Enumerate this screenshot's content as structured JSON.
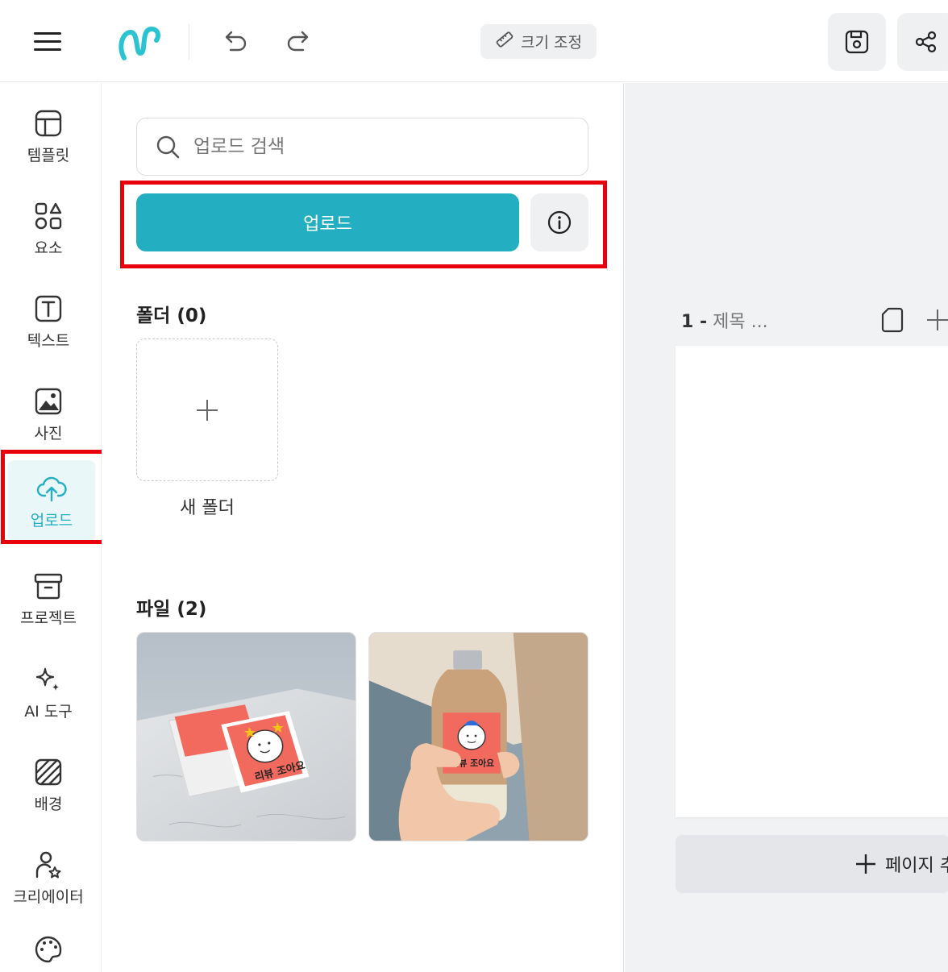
{
  "header": {
    "resize_label": "크기 조정"
  },
  "rail": {
    "items": [
      {
        "label": "템플릿",
        "icon": "template-icon"
      },
      {
        "label": "요소",
        "icon": "elements-icon"
      },
      {
        "label": "텍스트",
        "icon": "text-icon"
      },
      {
        "label": "사진",
        "icon": "photo-icon"
      },
      {
        "label": "업로드",
        "icon": "upload-cloud-icon",
        "active": true
      },
      {
        "label": "프로젝트",
        "icon": "archive-icon"
      },
      {
        "label": "AI 도구",
        "icon": "sparkle-icon"
      },
      {
        "label": "배경",
        "icon": "background-icon"
      },
      {
        "label": "크리에이터",
        "icon": "creator-icon"
      },
      {
        "label": "",
        "icon": "palette-icon"
      }
    ]
  },
  "panel": {
    "search_placeholder": "업로드 검색",
    "upload_label": "업로드",
    "folders_title": "폴더 (0)",
    "new_folder_label": "새 폴더",
    "files_title": "파일 (2)",
    "files": [
      {
        "name": "sticker-cards-photo",
        "sticker_text": "리뷰 조아요"
      },
      {
        "name": "bottle-sticker-photo",
        "sticker_text": "리뷰 조아요"
      }
    ]
  },
  "canvas": {
    "page_number": "1 -",
    "page_title": "제목 ...",
    "add_page_label": "페이지 추"
  },
  "colors": {
    "accent": "#23afc1",
    "highlight": "#e8000b"
  }
}
